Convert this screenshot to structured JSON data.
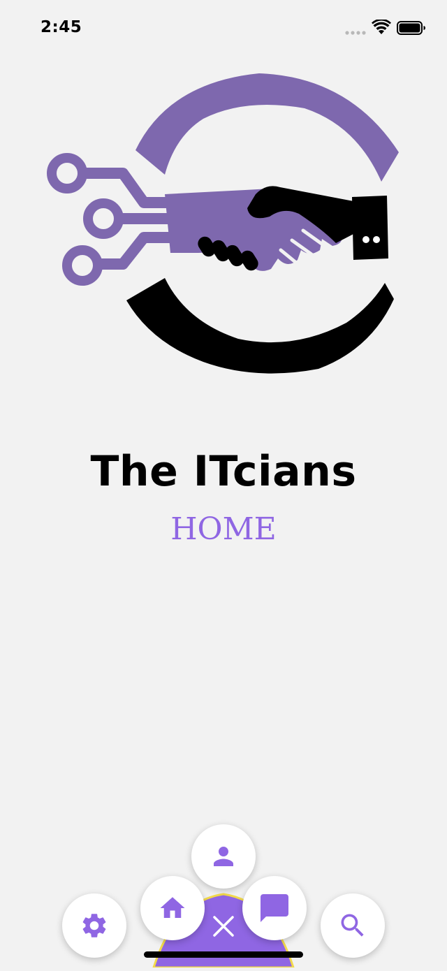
{
  "status_bar": {
    "time": "2:45"
  },
  "app": {
    "title": "The ITcians",
    "page": "HOME"
  },
  "colors": {
    "background": "#f2f2f2",
    "accent": "#8f66e3",
    "fab_menu": "#8f66e3",
    "fab_menu_border": "#f2d94b",
    "logo_purple": "#7e68ae",
    "logo_black": "#000000"
  },
  "menu": {
    "icons": [
      "gear-icon",
      "home-icon",
      "person-icon",
      "chat-bubble-icon",
      "search-icon",
      "close-icon"
    ]
  }
}
